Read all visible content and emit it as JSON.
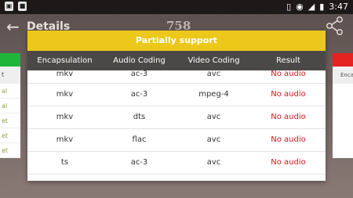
{
  "statusbar": {
    "time": "3:47",
    "icons": [
      "image-icon",
      "app-icon",
      "vibrate-icon",
      "wifi-icon",
      "signal-icon",
      "battery-icon"
    ]
  },
  "appbar": {
    "title": "Details",
    "count": "758"
  },
  "side_left": {
    "sub": "t",
    "rows": [
      "al",
      "al",
      "et",
      "et",
      "et"
    ]
  },
  "side_right": {
    "sub": "Enca"
  },
  "dialog": {
    "title": "Partially support",
    "headers": [
      "Encapsulation",
      "Audio Coding",
      "Video Coding",
      "Result"
    ],
    "rows": [
      [
        "mkv",
        "ac-3",
        "avc",
        "No audio"
      ],
      [
        "mkv",
        "ac-3",
        "mpeg-4",
        "No audio"
      ],
      [
        "mkv",
        "dts",
        "avc",
        "No audio"
      ],
      [
        "mkv",
        "flac",
        "avc",
        "No audio"
      ],
      [
        "ts",
        "ac-3",
        "avc",
        "No audio"
      ]
    ]
  },
  "colors": {
    "accent": "#ecc81a",
    "result": "#e0121b",
    "header": "#4b4848"
  }
}
